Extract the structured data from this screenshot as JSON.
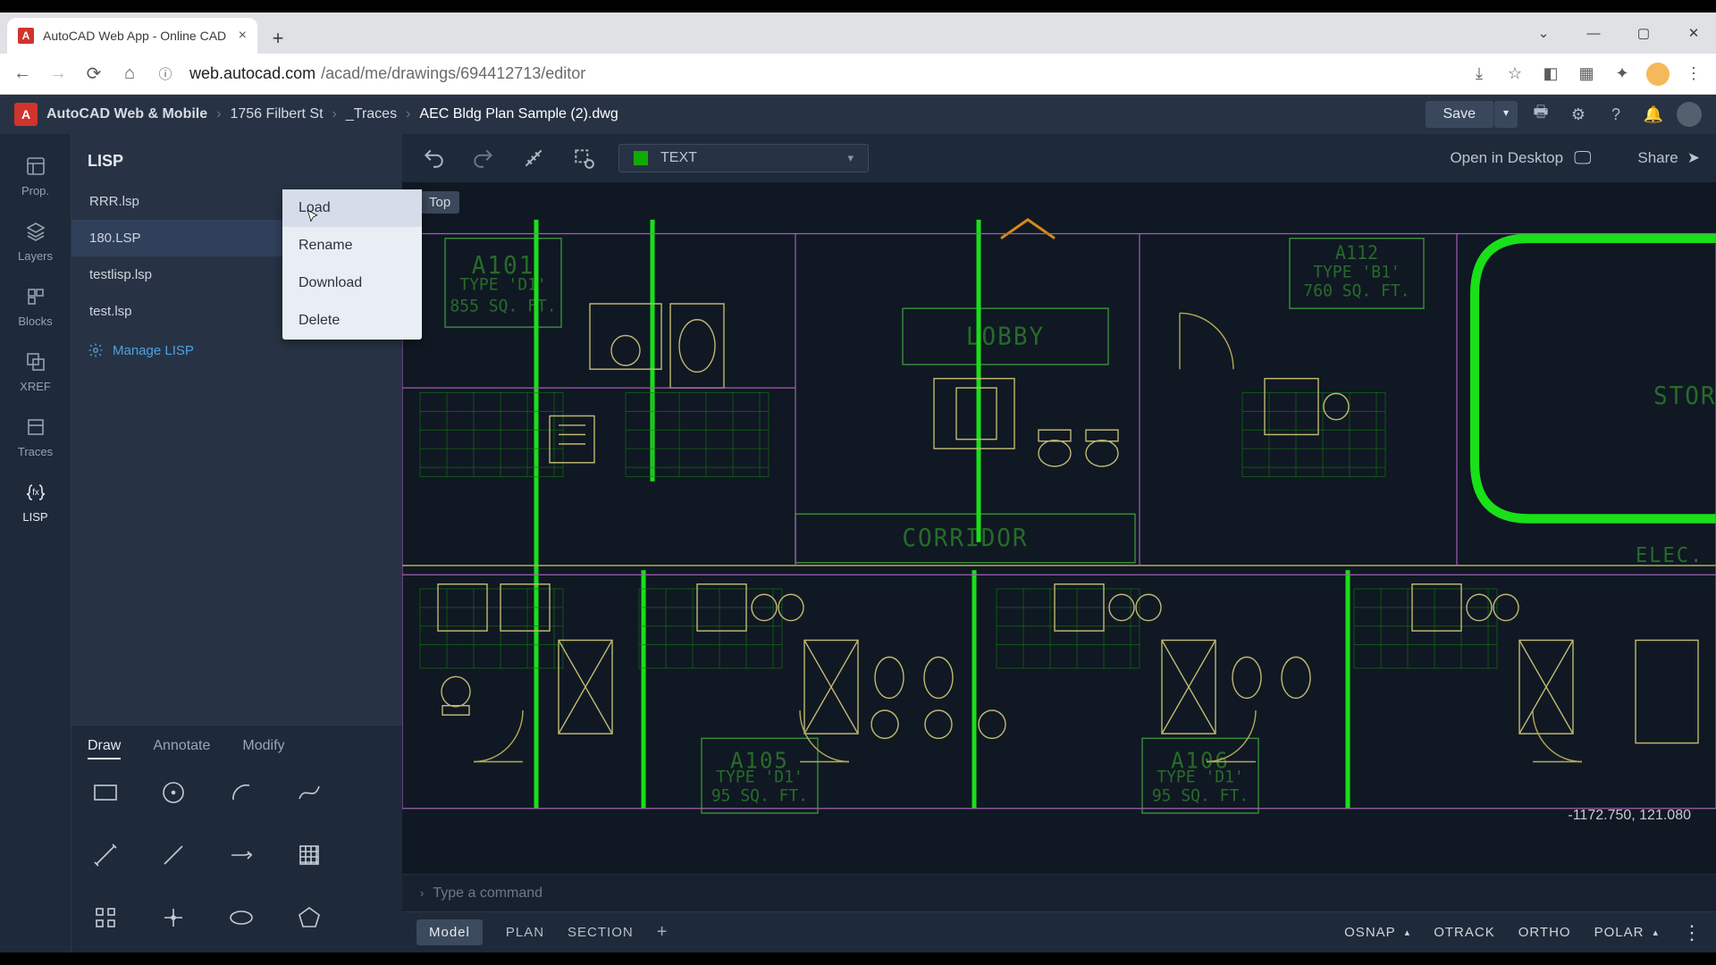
{
  "browser": {
    "tab_title": "AutoCAD Web App - Online CAD",
    "url_host": "web.autocad.com",
    "url_path": "/acad/me/drawings/694412713/editor"
  },
  "topbar": {
    "product": "AutoCAD Web & Mobile",
    "crumbs": [
      "1756 Filbert St",
      "_Traces",
      "AEC Bldg Plan Sample (2).dwg"
    ],
    "save_label": "Save"
  },
  "rail": {
    "items": [
      {
        "label": "Prop."
      },
      {
        "label": "Layers"
      },
      {
        "label": "Blocks"
      },
      {
        "label": "XREF"
      },
      {
        "label": "Traces"
      },
      {
        "label": "LISP"
      }
    ],
    "active_index": 5
  },
  "panel": {
    "title": "LISP",
    "files": [
      "RRR.lsp",
      "180.LSP",
      "testlisp.lsp",
      "test.lsp"
    ],
    "manage_label": "Manage LISP",
    "context_menu": [
      "Load",
      "Rename",
      "Download",
      "Delete"
    ]
  },
  "draw_tabs": {
    "items": [
      "Draw",
      "Annotate",
      "Modify"
    ],
    "active": 0
  },
  "canvas_bar": {
    "layer_label": "TEXT",
    "open_desktop": "Open in Desktop",
    "share": "Share"
  },
  "canvas": {
    "view_label": "Top",
    "coords": "-1172.750, 121.080",
    "rooms": {
      "a101": {
        "name": "A101",
        "type": "TYPE 'D1'",
        "sq": "855 SQ. FT."
      },
      "a112": {
        "name": "A112",
        "type": "TYPE 'B1'",
        "sq": "760 SQ. FT."
      },
      "lobby": "LOBBY",
      "corridor": "CORRIDOR",
      "storage": "STORAGE",
      "closet": "ELEC. CLOSET",
      "a105": {
        "name": "A105",
        "type": "TYPE 'D1'",
        "sq": "95 SQ. FT."
      },
      "a106": {
        "name": "A106",
        "type": "TYPE 'D1'",
        "sq": "95 SQ. FT."
      }
    }
  },
  "cmd": {
    "placeholder": "Type a command"
  },
  "sheets": {
    "tabs": [
      "Model",
      "PLAN",
      "SECTION"
    ],
    "active": 0
  },
  "snaps": [
    "OSNAP",
    "OTRACK",
    "ORTHO",
    "POLAR"
  ]
}
